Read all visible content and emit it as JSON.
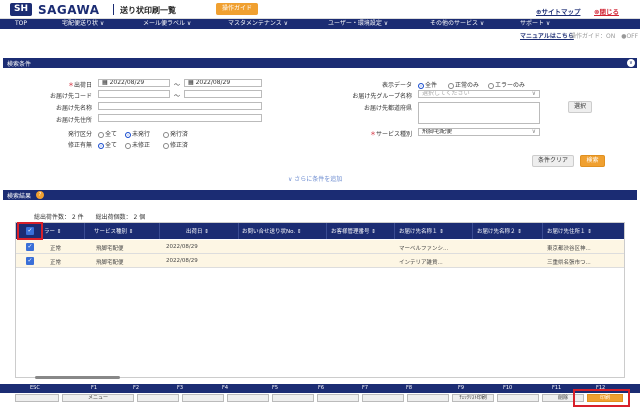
{
  "header": {
    "logo_mark": "SH",
    "logo_text": "SAGAWA",
    "title": "送り状印刷一覧",
    "guide_button": "操作ガイド",
    "sitemap": "⊕サイトマップ",
    "close": "⊗閉じる"
  },
  "nav": {
    "items": [
      "TOP",
      "宅配便送り状 ∨",
      "メール便ラベル ∨",
      "マスタメンテナンス ∨",
      "ユーザー・環境設定 ∨",
      "その他のサービス ∨",
      "サポート ∨"
    ]
  },
  "subbar": {
    "manual": "マニュアルはこちら",
    "guide_status": "操作ガイド：ON　●OFF"
  },
  "search": {
    "header": "検索条件",
    "toggle": "∨",
    "ship_date_label": "出荷日",
    "date_from": "2022/08/29",
    "range_sep": "～",
    "date_to": "2022/08/29",
    "dest_code_label": "お届け先コード",
    "dest_name_label": "お届け先名称",
    "dest_addr_label": "お届け先住所",
    "issue_label": "発行区分",
    "issue_options": [
      "全て",
      "未発行",
      "発行済"
    ],
    "modify_label": "修正有無",
    "modify_options": [
      "全て",
      "未修正",
      "修正済"
    ],
    "display_label": "表示データ",
    "display_options": [
      "全件",
      "正常のみ",
      "エラーのみ"
    ],
    "group_label": "お届け先グループ名称",
    "group_placeholder": "選択してください",
    "pref_label": "お届け先都道府県",
    "select_button": "選択",
    "service_label": "サービス種別",
    "service_value": "飛脚宅配便",
    "clear_button": "条件クリア",
    "search_button": "検索",
    "more_link": "∨ さらに条件を追加"
  },
  "results": {
    "header": "検索結果",
    "help": "?",
    "counts": "総出荷件数：  2 件　　総出荷個数：  2 個",
    "columns": [
      "ラー ⇕",
      "サービス種別 ⇕",
      "出荷日 ⇕",
      "お問い合せ送り状No. ⇕",
      "お客様管理番号 ⇕",
      "お届け先名称１ ⇕",
      "お届け先名称２ ⇕",
      "お届け先住所１ ⇕"
    ],
    "rows": [
      {
        "status": "正常",
        "service": "飛脚宅配便",
        "date": "2022/08/29",
        "tracking": "",
        "cust_no": "",
        "name1": "マーベルファンシ...",
        "name2": "",
        "addr1": "東京都渋谷区神..."
      },
      {
        "status": "正常",
        "service": "飛脚宅配便",
        "date": "2022/08/29",
        "tracking": "",
        "cust_no": "",
        "name1": "インテリア雑貨...",
        "name2": "",
        "addr1": "三重県名張市つ..."
      }
    ]
  },
  "fkeys": {
    "labels": [
      "ESC",
      "F1",
      "F2",
      "F3",
      "F4",
      "F5",
      "F6",
      "F7",
      "F8",
      "F9",
      "F10",
      "F11",
      "F12"
    ],
    "f1": "メニュー",
    "f9": "ﾁｪｯｸﾘｽﾄ印刷",
    "f11": "削除",
    "f12": "印刷"
  },
  "colors": {
    "navy": "#1b2c73",
    "orange": "#f0a030",
    "highlight": "#d8202a"
  }
}
